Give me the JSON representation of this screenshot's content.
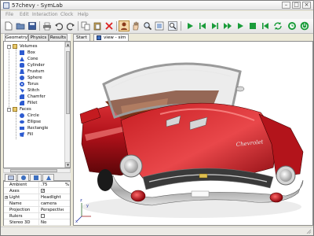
{
  "window": {
    "title": "57chevy - SymLab"
  },
  "window_controls": {
    "minimize": "–",
    "maximize": "□",
    "close": "×"
  },
  "menu": [
    "File",
    "Edit",
    "Interaction",
    "Clock",
    "Help"
  ],
  "toolbar": {
    "buttons": [
      "new-icon",
      "open-icon",
      "save-icon",
      "print-icon",
      "undo-icon",
      "redo-icon",
      "copy-icon",
      "paste-icon",
      "delete-icon",
      "interact-icon",
      "pan-icon",
      "zoom-icon",
      "fit-icon",
      "zoom-extents-icon",
      "play-icon",
      "step-back-icon",
      "step-forward-icon",
      "skip-end-icon",
      "play-alt-icon",
      "stop-icon",
      "reset-icon",
      "repeat-icon",
      "clock-icon",
      "power-icon"
    ]
  },
  "left_panel": {
    "tabs": [
      "Geometry",
      "Physics",
      "Results"
    ],
    "active_tab": "Geometry",
    "tree": {
      "volumes_label": "Volumes",
      "volumes": [
        "Box",
        "Cone",
        "Cylinder",
        "Frustum",
        "Sphere",
        "Torus",
        "Stitch",
        "Chamfer",
        "Fillet"
      ],
      "faces_label": "Faces",
      "faces": [
        "Circle",
        "Ellipse",
        "Rectangle",
        "Fill"
      ]
    }
  },
  "properties": {
    "rows": [
      {
        "key": "Ambient",
        "value": ".75",
        "unit": "%"
      },
      {
        "key": "Axes",
        "value": "✓",
        "unit": ""
      },
      {
        "key": "Light",
        "value": "Headlight",
        "unit": ""
      },
      {
        "key": "Name",
        "value": "camera",
        "unit": ""
      },
      {
        "key": "Projection",
        "value": "Perspective",
        "unit": ""
      },
      {
        "key": "Rulers",
        "value": "",
        "unit": ""
      },
      {
        "key": "Stereo 3D",
        "value": "No",
        "unit": ""
      }
    ]
  },
  "document_tabs": [
    {
      "label": "Start"
    },
    {
      "label": "view - sim"
    }
  ],
  "viewport": {
    "emblem_text": "Chevrolet",
    "axis_labels": {
      "z": "z",
      "y": "y",
      "x": "x"
    },
    "colors": {
      "body": "#b0111a",
      "body_highlight": "#e2363a",
      "chrome": "#c9c9c9",
      "interior": "#7a3318"
    }
  }
}
